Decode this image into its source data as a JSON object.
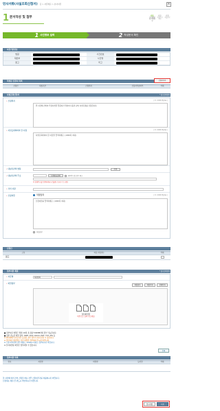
{
  "header": {
    "title": "민사서류(사실조회신청서)",
    "crumb": "홈 > 서류제출 > 민사서류",
    "close": "×"
  },
  "step": {
    "number": "1",
    "title": "문서작성 및 첨부",
    "indicators": [
      {
        "n": "01",
        "label": "문서작성 및 파일첨부",
        "active": true
      },
      {
        "n": "02",
        "label": "작성문서 확인",
        "active": false
      },
      {
        "n": "03",
        "label": "제출완료",
        "active": false
      }
    ]
  },
  "tabs": [
    {
      "num": "1",
      "label": "사건정보 입력"
    },
    {
      "num": "2",
      "label": "작성문서 확인"
    }
  ],
  "case": {
    "title": "사건기본정보",
    "rows": [
      {
        "l1": "법원",
        "l2": "사건번호"
      },
      {
        "l1": "재판부",
        "l2": "사건명"
      },
      {
        "l1": "원고",
        "l2": "피고"
      }
    ]
  },
  "appl": {
    "title": "작성된 신청서 목록",
    "add": "신청서추가",
    "headers": [
      "신청인",
      "대상기관",
      "신청취지",
      "신청서작성여부",
      "삭제"
    ]
  },
  "detail": {
    "title": "사실조회신청서",
    "required": "* 필수입력항목",
    "purpose_label": "신청취지",
    "purpose_text": "위 사건에 관하여 주장사실을 입증하기 위하여 다음과 같이 사실조회를 신청합니다.",
    "purpose_count": "( 0 / 2000 Bytes )",
    "fact_label": "사실조회하여야 할 사항",
    "fact_text": "사실조회하여야 할 사항을 입력하세요. (1000자 이내)",
    "fact_count": "( 0 / 2000 Bytes )",
    "org_label": "대상기관의 명칭",
    "org_btn": "조회",
    "addr_label": "대상기관의 주소",
    "addr_btn": "우편번호검색",
    "addr_check": "해외주소일 경우 체크",
    "addr_help": "※ 상세주소를 입력하세요 (건물명, 동호수 등 포함)",
    "etc_label": "기타 사항",
    "etc_text": "기타 사항이 있으면 입력하세요.",
    "reason_label": "신청이유",
    "radio": "직접입력",
    "reason_text": "신청이유를 입력하세요. (1000자 이내)",
    "reason_count": "( 0 / 2000 Bytes )",
    "file_opt": "파일첨부"
  },
  "party": {
    "title": "신청인",
    "headers": [
      "구분",
      "이름 (대표자)",
      "삭제"
    ],
    "row": "원고"
  },
  "attach": {
    "title": "첨부서류 제출",
    "required": "* 필수입력항목",
    "type_label": "서류명",
    "type_value": "직접입력",
    "file_label": "파일첨부",
    "buttons": [
      "파일첨부",
      "파일삭제",
      "전체삭제"
    ],
    "drop1": "첨부파일을",
    "drop2": "마우스로 끌어 넣으세요",
    "notes": [
      "■ 첨부서류 파일은 최대 10개, 총 용량 500MB까지 첨부 가능합니다.",
      "■ 첨부 가능한 파일 형식: HWP, DOC, DOCX, PDF, TXT, JPG 등",
      "※ 파일명에 특수문자가 포함된 경우 첨부가 되지 않을 수 있습니다.",
      "※ 첨부서류 종류별로 각각 파일을 첨부하여 주시기 바랍니다.",
      "※ 스캔 이미지의 경우 해상도 200dpi 이하로 첨부하시기 바랍니다.",
      "※ 전자서명된 파일은 첨부하실 수 없습니다."
    ],
    "done": "등록"
  },
  "list": {
    "title": "첨부서류 목록",
    "headers": [
      "번호",
      "서류명",
      "파일명",
      "등록일",
      "삭제"
    ]
  },
  "bottom": {
    "line1": "한 사건에 여러 건의 신청을 하는 경우 신청서추가를 이용하시기 바랍니다.",
    "line2": "신청서는 제출 전 반드시 확인하시기 바랍니다.",
    "save": "임시저장",
    "next": "다음"
  }
}
